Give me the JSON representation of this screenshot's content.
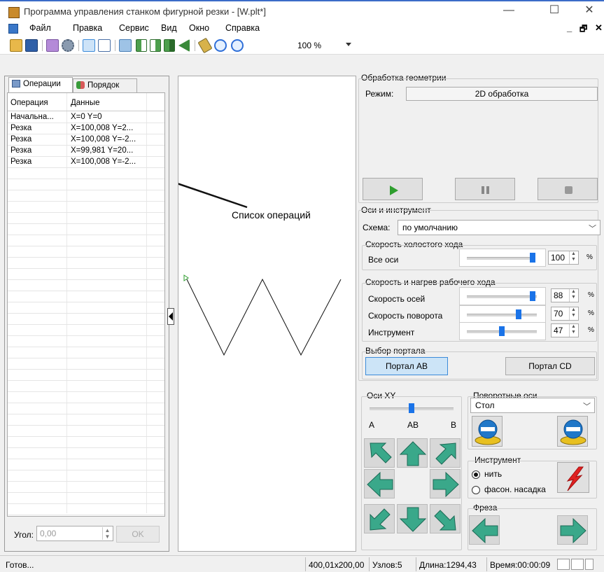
{
  "window": {
    "title": "Программа управления станком фигурной резки - [W.plt*]",
    "controls": {
      "minimize": "—",
      "maximize": "☐",
      "close": "✕"
    }
  },
  "menu": {
    "items": [
      "Файл",
      "Правка",
      "Сервис",
      "Вид",
      "Окно",
      "Справка"
    ],
    "mdi_minimize": "_",
    "mdi_restore": "🗗",
    "mdi_close": "✕"
  },
  "toolbar": {
    "zoom": "100 %",
    "icons": [
      "open-folder-icon",
      "save-icon",
      "properties-icon",
      "settings-gear-icon",
      "grid-view-icon",
      "edit-icon",
      "transform-icon",
      "mirror-vertical-icon",
      "mirror-horizontal-icon",
      "rotate-icon",
      "flip-icon",
      "fit-icon",
      "zoom-in-icon",
      "zoom-out-icon"
    ]
  },
  "left_panel": {
    "tabs": [
      {
        "label": "Операции",
        "active": true
      },
      {
        "label": "Порядок",
        "active": false
      }
    ],
    "columns": [
      "Операция",
      "Данные"
    ],
    "rows": [
      {
        "op": "Начальна...",
        "data": "X=0 Y=0"
      },
      {
        "op": "Резка",
        "data": "X=100,008 Y=2..."
      },
      {
        "op": "Резка",
        "data": "X=100,008 Y=-2..."
      },
      {
        "op": "Резка",
        "data": "X=99,981 Y=20..."
      },
      {
        "op": "Резка",
        "data": "X=100,008 Y=-2..."
      }
    ],
    "angle_label": "Угол:",
    "angle_value": "0,00",
    "ok_label": "OK"
  },
  "canvas": {
    "annotation": "Список операций"
  },
  "geometry": {
    "title": "Обработка геометрии",
    "mode_label": "Режим:",
    "mode_value": "2D обработка"
  },
  "axes_tool": {
    "title": "Оси и инструмент",
    "scheme_label": "Схема:",
    "scheme_value": "по умолчанию",
    "idle_title": "Скорость холостого хода",
    "all_axes_label": "Все оси",
    "all_axes_value": "100",
    "work_title": "Скорость и нагрев рабочего хода",
    "axis_speed_label": "Скорость осей",
    "axis_speed_value": "88",
    "rotate_speed_label": "Скорость поворота",
    "rotate_speed_value": "70",
    "tool_label": "Инструмент",
    "tool_value": "47",
    "percent": "%",
    "slider_levels": {
      "all_axes": 1.0,
      "axis_speed": 0.88,
      "rotate_speed": 0.7,
      "tool": 0.47
    }
  },
  "portal": {
    "title": "Выбор портала",
    "ab_label": "Портал AB",
    "cd_label": "Портал CD"
  },
  "axes_xy": {
    "title": "Оси XY",
    "tick_a": "A",
    "tick_ab": "AB",
    "tick_b": "B",
    "slider_level": 0.5
  },
  "rotary": {
    "title": "Поворотные оси",
    "value": "Стол"
  },
  "instrument": {
    "title": "Инструмент",
    "opt1": "нить",
    "opt2": "фасон. насадка"
  },
  "mill": {
    "title": "Фреза"
  },
  "status": {
    "ready": "Готов...",
    "size": "400,01x200,00",
    "nodes": "Узлов:5",
    "length": "Длина:1294,43",
    "time": "Время:00:00:09"
  },
  "colors": {
    "accent": "#1a73e8",
    "arrow_green": "#3aa88a",
    "play_green": "#2e9e2e"
  }
}
